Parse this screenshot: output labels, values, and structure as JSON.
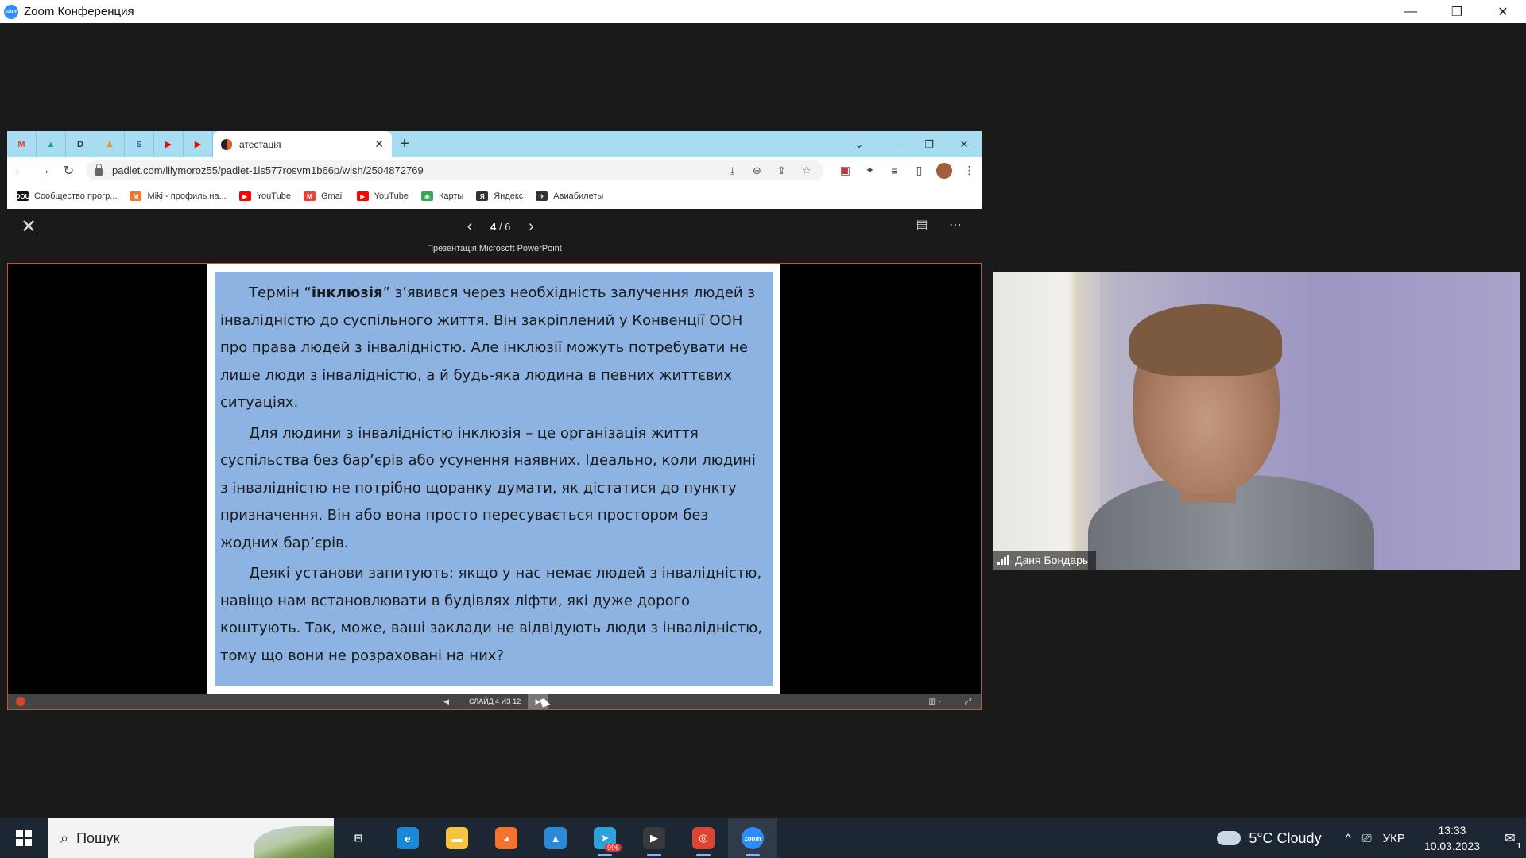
{
  "zoom": {
    "window_title": "Zoom Конференция",
    "logo_text": "zoom",
    "controls": {
      "minimize": "—",
      "restore": "❐",
      "close": "✕"
    }
  },
  "browser": {
    "pinned_tabs": [
      {
        "icon": "gmail-icon",
        "glyph": "M",
        "color": "#ea4335"
      },
      {
        "icon": "google-drive-icon",
        "glyph": "▲",
        "color": "#1fa463"
      },
      {
        "icon": "dou-icon",
        "glyph": "D",
        "color": "#333333"
      },
      {
        "icon": "ok-icon",
        "glyph": "♟",
        "color": "#f7931e"
      },
      {
        "icon": "s-icon",
        "glyph": "S",
        "color": "#2a5db0"
      },
      {
        "icon": "youtube-icon",
        "glyph": "▶",
        "color": "#ff0000"
      },
      {
        "icon": "youtube-icon",
        "glyph": "▶",
        "color": "#ff0000"
      }
    ],
    "active_tab": {
      "title": "атестація",
      "close": "✕"
    },
    "new_tab": "+",
    "tab_controls": {
      "menu": "⌄",
      "minimize": "—",
      "restore": "❐",
      "close": "✕"
    },
    "nav": {
      "back": "←",
      "forward": "→",
      "reload": "↻"
    },
    "url": "padlet.com/lilymoroz55/padlet-1ls577rosvm1b66p/wish/2504872769",
    "omni_icons": [
      "⤓",
      "⊖",
      "⇪",
      "☆"
    ],
    "ext_icons": [
      "▣",
      "✦",
      "≡",
      "▯",
      "⋮"
    ],
    "bookmarks": [
      {
        "label": "Сообщество прогр...",
        "icon": "dou-icon",
        "glyph": "DOU",
        "color": "#111111"
      },
      {
        "label": "Miki - профиль на...",
        "icon": "miki-icon",
        "glyph": "M",
        "color": "#f0782a"
      },
      {
        "label": "YouTube",
        "icon": "youtube-icon",
        "glyph": "▶",
        "color": "#ff0000"
      },
      {
        "label": "Gmail",
        "icon": "gmail-icon",
        "glyph": "M",
        "color": "#ea4335"
      },
      {
        "label": "YouTube",
        "icon": "youtube-icon",
        "glyph": "▶",
        "color": "#ff0000"
      },
      {
        "label": "Карты",
        "icon": "maps-icon",
        "glyph": "◉",
        "color": "#34a853"
      },
      {
        "label": "Яндекс",
        "icon": "yandex-icon",
        "glyph": "Я",
        "color": "#333333"
      },
      {
        "label": "Авиабилеты",
        "icon": "plane-icon",
        "glyph": "✈",
        "color": "#333333"
      }
    ]
  },
  "viewer": {
    "close": "✕",
    "prev": "‹",
    "next": "›",
    "page_current": "4",
    "page_total": "/ 6",
    "caption": "Презентація Microsoft PowerPoint",
    "right_icons": [
      "▤",
      "⋯"
    ]
  },
  "slide": {
    "p1_before": "Термін “",
    "p1_bold": "інклюзія",
    "p1_after": "” з’явився через необхідність залучення людей з інвалідністю до суспільного життя. Він закріплений у Конвенції ООН про права людей з інвалідністю. Але інклюзії можуть потребувати не лише люди з інвалідністю, а й будь-яка людина в певних життєвих ситуаціях.",
    "p2": "Для людини з інвалідністю інклюзія – це організація життя суспільства без бар’єрів або усунення наявних. Ідеально, коли людині з інвалідністю не потрібно щоранку думати, як дістатися до пункту призначення. Він або вона просто пересувається простором без жодних бар’єрів.",
    "p3": "Деякі установи запитують: якщо у нас немає людей з інвалідністю, навіщо нам встановлювати в будівлях ліфти, які дуже дорого коштують. Так, може, ваші заклади не відвідують люди з інвалідністю, тому що вони не розраховані на них?"
  },
  "ppt_bar": {
    "prev": "◀",
    "counter": "СЛАЙД 4 ИЗ 12",
    "next": "▶",
    "reading_view": "▥ ·",
    "fullscreen": "⤢"
  },
  "participant": {
    "name": "Даня Бондарь"
  },
  "taskbar": {
    "search_placeholder": "Пошук",
    "apps": [
      {
        "name": "task-view-icon",
        "glyph": "⊟",
        "bg": "transparent",
        "running": false
      },
      {
        "name": "edge-icon",
        "glyph": "e",
        "bg": "#1b8ad6",
        "running": false
      },
      {
        "name": "file-explorer-icon",
        "glyph": "▬",
        "bg": "#f5c242",
        "running": false
      },
      {
        "name": "firefox-icon",
        "glyph": "◕",
        "bg": "#f5732c",
        "running": false
      },
      {
        "name": "photos-icon",
        "glyph": "▲",
        "bg": "#2a8ad6",
        "running": false
      },
      {
        "name": "telegram-icon",
        "glyph": "➤",
        "bg": "#2aa3dd",
        "running": true,
        "badge": "996"
      },
      {
        "name": "media-player-icon",
        "glyph": "▶",
        "bg": "#3a3a3a",
        "running": true
      },
      {
        "name": "chrome-icon",
        "glyph": "◎",
        "bg": "#dd4433",
        "running": true
      },
      {
        "name": "zoom-icon",
        "glyph": "zoom",
        "bg": "#2d8cff",
        "running": true,
        "active": true
      }
    ],
    "weather": "5°C  Cloudy",
    "tray_icons": {
      "chevron": "^",
      "camera": "⎚",
      "lang": "УКР"
    },
    "time": "13:33",
    "date": "10.03.2023",
    "notif": "✉",
    "notif_count": "1"
  }
}
